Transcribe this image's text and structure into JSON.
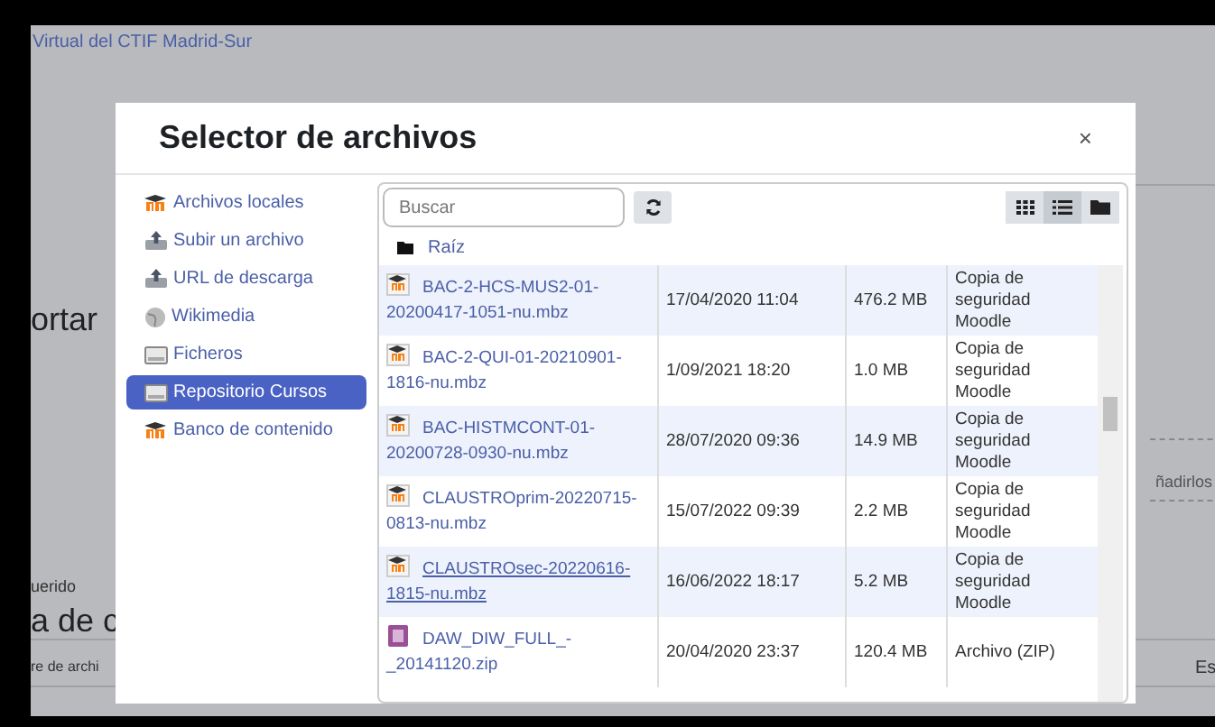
{
  "background": {
    "site_title": "Virtual del CTIF Madrid-Sur",
    "heading": "ortar",
    "label": "uerido",
    "heading_2": "a de c",
    "column_label": "re de archi",
    "hint": "ñadirlos",
    "column_label_2": "Es"
  },
  "dialog": {
    "title": "Selector de archivos",
    "close": "×",
    "repositories": [
      {
        "label": "Archivos locales",
        "kind": "moodle",
        "selected": false
      },
      {
        "label": "Subir un archivo",
        "kind": "upload",
        "selected": false
      },
      {
        "label": "URL de descarga",
        "kind": "upload",
        "selected": false
      },
      {
        "label": "Wikimedia",
        "kind": "globe",
        "selected": false
      },
      {
        "label": "Ficheros",
        "kind": "drive",
        "selected": false
      },
      {
        "label": "Repositorio Cursos",
        "kind": "drive",
        "selected": true
      },
      {
        "label": "Banco de contenido",
        "kind": "moodle",
        "selected": false
      }
    ],
    "search": {
      "placeholder": "Buscar"
    },
    "views": [
      {
        "kind": "grid",
        "selected": false
      },
      {
        "kind": "list",
        "selected": true
      },
      {
        "kind": "folder",
        "selected": false
      }
    ],
    "breadcrumb": "Raíz",
    "files": [
      {
        "name": "BAC-2-HCS-MUS2-01-20200417-1051-nu.mbz",
        "kind": "backup",
        "date": "17/04/2020 11:04",
        "size": "476.2 MB",
        "type": "Copia de seguridad Moodle",
        "hovered": false
      },
      {
        "name": "BAC-2-QUI-01-20210901-1816-nu.mbz",
        "kind": "backup",
        "date": "1/09/2021 18:20",
        "size": "1.0 MB",
        "type": "Copia de seguridad Moodle",
        "hovered": false
      },
      {
        "name": "BAC-HISTMCONT-01-20200728-0930-nu.mbz",
        "kind": "backup",
        "date": "28/07/2020 09:36",
        "size": "14.9 MB",
        "type": "Copia de seguridad Moodle",
        "hovered": false
      },
      {
        "name": "CLAUSTROprim-20220715-0813-nu.mbz",
        "kind": "backup",
        "date": "15/07/2022 09:39",
        "size": "2.2 MB",
        "type": "Copia de seguridad Moodle",
        "hovered": false
      },
      {
        "name": "CLAUSTROsec-20220616-1815-nu.mbz",
        "kind": "backup",
        "date": "16/06/2022 18:17",
        "size": "5.2 MB",
        "type": "Copia de seguridad Moodle",
        "hovered": true
      },
      {
        "name": "DAW_DIW_FULL_-_20141120.zip",
        "kind": "zip",
        "date": "20/04/2020 23:37",
        "size": "120.4 MB",
        "type": "Archivo (ZIP)",
        "hovered": false
      }
    ]
  }
}
